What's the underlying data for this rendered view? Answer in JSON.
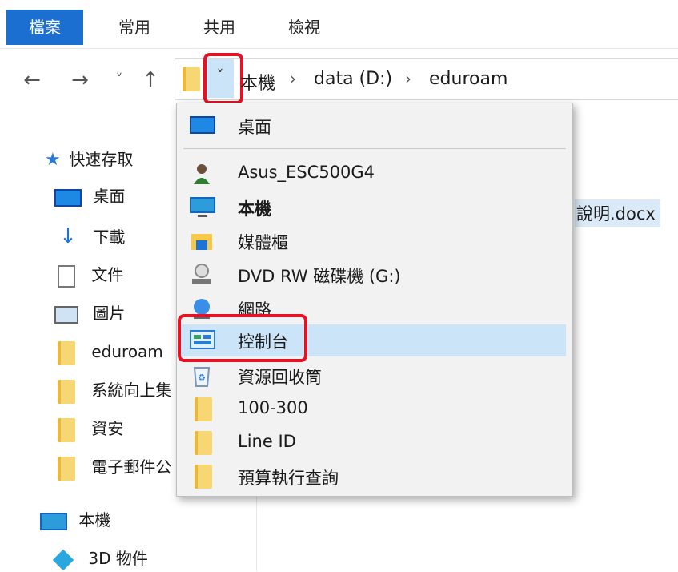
{
  "ribbon": {
    "tabs": [
      {
        "label": "檔案",
        "active": true
      },
      {
        "label": "常用",
        "active": false
      },
      {
        "label": "共用",
        "active": false
      },
      {
        "label": "檢視",
        "active": false
      }
    ]
  },
  "nav": {
    "back_icon": "←",
    "forward_icon": "→",
    "recent_icon": "˅",
    "up_icon": "↑"
  },
  "address": {
    "dropdown_icon": "˅",
    "crumbs": [
      "本機",
      "data (D:)",
      "eduroam"
    ],
    "separator": "›"
  },
  "sidebar": {
    "items": [
      {
        "label": "快速存取",
        "icon": "star-icon"
      },
      {
        "label": "桌面",
        "icon": "desktop-icon"
      },
      {
        "label": "下載",
        "icon": "download-icon"
      },
      {
        "label": "文件",
        "icon": "document-icon"
      },
      {
        "label": "圖片",
        "icon": "picture-icon"
      },
      {
        "label": "eduroam",
        "icon": "folder-icon"
      },
      {
        "label": "系統向上集",
        "icon": "folder-icon"
      },
      {
        "label": "資安",
        "icon": "folder-icon"
      },
      {
        "label": "電子郵件公",
        "icon": "folder-icon"
      },
      {
        "label": "本機",
        "icon": "computer-icon"
      },
      {
        "label": "3D 物件",
        "icon": "cube-icon"
      }
    ]
  },
  "content": {
    "file_label": "說明.docx"
  },
  "dropdown": {
    "items": [
      {
        "label": "桌面",
        "icon": "desktop-icon",
        "bold": false
      },
      {
        "label": "Asus_ESC500G4",
        "icon": "user-icon",
        "bold": false
      },
      {
        "label": "本機",
        "icon": "computer-icon",
        "bold": true
      },
      {
        "label": "媒體櫃",
        "icon": "library-icon",
        "bold": false
      },
      {
        "label": "DVD RW 磁碟機 (G:)",
        "icon": "dvd-drive-icon",
        "bold": false
      },
      {
        "label": "網路",
        "icon": "network-icon",
        "bold": false
      },
      {
        "label": "控制台",
        "icon": "control-panel-icon",
        "bold": false,
        "selected": true
      },
      {
        "label": "資源回收筒",
        "icon": "recycle-bin-icon",
        "bold": false
      },
      {
        "label": "100-300",
        "icon": "folder-icon",
        "bold": false
      },
      {
        "label": "Line ID",
        "icon": "folder-icon",
        "bold": false
      },
      {
        "label": "預算執行查詢",
        "icon": "folder-icon",
        "bold": false
      }
    ]
  },
  "colors": {
    "accent": "#1a6fd1",
    "selection": "#cce4f7",
    "highlight_box": "#e81123",
    "folder": "#f7d674"
  }
}
